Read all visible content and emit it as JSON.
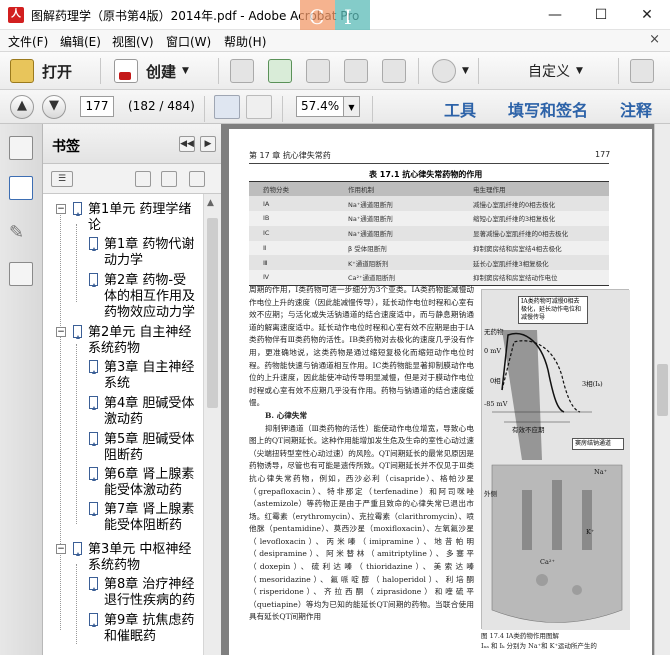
{
  "window": {
    "title": "图解药理学（原书第4版）2014年.pdf - Adobe Acrobat Pro",
    "watermark_letters": [
      "C",
      "I"
    ],
    "controls": {
      "minimize": "—",
      "maximize": "☐",
      "close": "✕"
    }
  },
  "menubar": {
    "items": [
      "文件(F)",
      "编辑(E)",
      "视图(V)",
      "窗口(W)",
      "帮助(H)"
    ],
    "close": "×"
  },
  "toolbar": {
    "open_label": "打开",
    "create_label": "创建",
    "customize_label": "自定义"
  },
  "nav": {
    "page_input": "177",
    "page_count": "(182 / 484)",
    "zoom": "57.4%",
    "panes": [
      "工具",
      "填写和签名",
      "注释"
    ]
  },
  "bookmarks": {
    "title": "书签",
    "items": [
      {
        "label_lines": [
          "第1单元  药理学绪",
          "论"
        ],
        "level": 0,
        "expanded": true
      },
      {
        "label_lines": [
          "第1章  药物代谢",
          "动力学"
        ],
        "level": 1
      },
      {
        "label_lines": [
          "第2章  药物-受",
          "体的相互作用及",
          "药物效应动力学"
        ],
        "level": 1
      },
      {
        "label_lines": [
          "第2单元  自主神经",
          "系统药物"
        ],
        "level": 0,
        "expanded": true
      },
      {
        "label_lines": [
          "第3章  自主神经",
          "系统"
        ],
        "level": 1
      },
      {
        "label_lines": [
          "第4章  胆碱受体",
          "激动药"
        ],
        "level": 1
      },
      {
        "label_lines": [
          "第5章  胆碱受体",
          "阻断药"
        ],
        "level": 1
      },
      {
        "label_lines": [
          "第6章  肾上腺素",
          "能受体激动药"
        ],
        "level": 1
      },
      {
        "label_lines": [
          "第7章  肾上腺素",
          "能受体阻断药"
        ],
        "level": 1
      },
      {
        "label_lines": [
          "第3单元  中枢神经",
          "系统药物"
        ],
        "level": 0,
        "expanded": true
      },
      {
        "label_lines": [
          "第8章  治疗神经",
          "退行性疾病的药"
        ],
        "level": 1
      },
      {
        "label_lines": [
          "第9章  抗焦虑药",
          "和催眠药"
        ],
        "level": 1
      }
    ]
  },
  "document": {
    "running_head": "第 17 章    抗心律失常药",
    "page_number": "177",
    "table": {
      "title": "表 17.1    抗心律失常药物的作用",
      "headers": [
        "药物分类",
        "作用机制",
        "电生理作用"
      ],
      "rows": [
        [
          "ⅠA",
          "Na⁺通道阻断剂",
          "减慢心室肌纤维的0相去极化"
        ],
        [
          "ⅠB",
          "Na⁺通道阻断剂",
          "缩短心室肌纤维的3相复极化"
        ],
        [
          "ⅠC",
          "Na⁺通道阻断剂",
          "显著减慢心室肌纤维的0相去极化"
        ],
        [
          "Ⅱ",
          "β 受体阻断剂",
          "抑制窦房结和房室结4相去极化"
        ],
        [
          "Ⅲ",
          "K⁺通道阻断剂",
          "延长心室肌纤维3相复极化"
        ],
        [
          "Ⅳ",
          "Ca²⁺通道阻断剂",
          "抑制窦房结和房室结动作电位"
        ]
      ]
    },
    "paragraphs": [
      "周期的作用，Ⅰ类药物可进一步细分为3个亚类。ⅠA类药物能减慢动作电位上升的速度（因此能减慢传导），延长动作电位时程和心室有效不应期；与活化或失活钠通道的结合速度适中，而与静息期钠通道的解离速度适中。延长动作电位时程和心室有效不应期是由于ⅠA类药物伴有Ⅲ类药物的活性。ⅠB类药物对去极化的速度几乎没有作用，更准确地说，这类药物是通过缩短复极化而缩短动作电位时程。药物能快速与钠通道相互作用。ⅠC类药物能显著抑制膜动作电位的上升速度，因此能使冲动传导明显减慢，但是对于膜动作电位时程或心室有效不应期几乎没有作用。药物与钠通道的结合速度缓慢。",
      "B. 心律失常",
      "抑制钾通道（Ⅲ类药物的活性）能使动作电位增宽，导致心电图上的QT间期延长。这种作用能增加发生危及生命的室性心动过速（尖端扭转型室性心动过速）的风险。QT间期延长的最常见原因是药物诱导，尽管也有可能是遗传所致。QT间期延长并不仅见于Ⅲ类抗心律失常药物，例如，西沙必利（cisapride）、格帕沙星（grepafloxacin）、特非那定（terfenadine）和阿司咪唑（astemizole）等药物正是由于严重且致命的心律失常已退出市场。红霉素（erythromycin）、克拉霉素（clarithromycin）、喷他脒（pentamidine）、莫西沙星（moxifloxacin）、左氧氟沙星（levofloxacin）、丙米嗪（imipramine）、地昔帕明（desipramine）、阿米替林（amitriptyline）、多塞平（doxepin）、硫利达嗪（thioridazine）、美索达嗪（mesoridazine）、氟哌啶醇（haloperidol）、利培酮（risperidone）、齐拉西酮（ziprasidone）和喹硫平（quetiapine）等均为已知的能延长QT间期的药物。当联合使用具有延长QT间期作用"
    ],
    "figure": {
      "caption": "图 17.4    ⅠA类药物作用图解",
      "caption2": "Iₙₐ 和 I⁠ₖ 分别为 Na⁺和 K⁺运动所产生的",
      "annotations": [
        "ⅠA类药物可减慢0相去极化，延长动作电位和减慢传导",
        "窦房结钠通道"
      ],
      "labels": [
        "无药物",
        "0 mV",
        "0相",
        "3相(Iₖ)",
        "-85 mV",
        "有效不应期",
        "Na⁺",
        "K⁺",
        "Ca²⁺",
        "外侧",
        "舒张期下传动"
      ]
    }
  }
}
